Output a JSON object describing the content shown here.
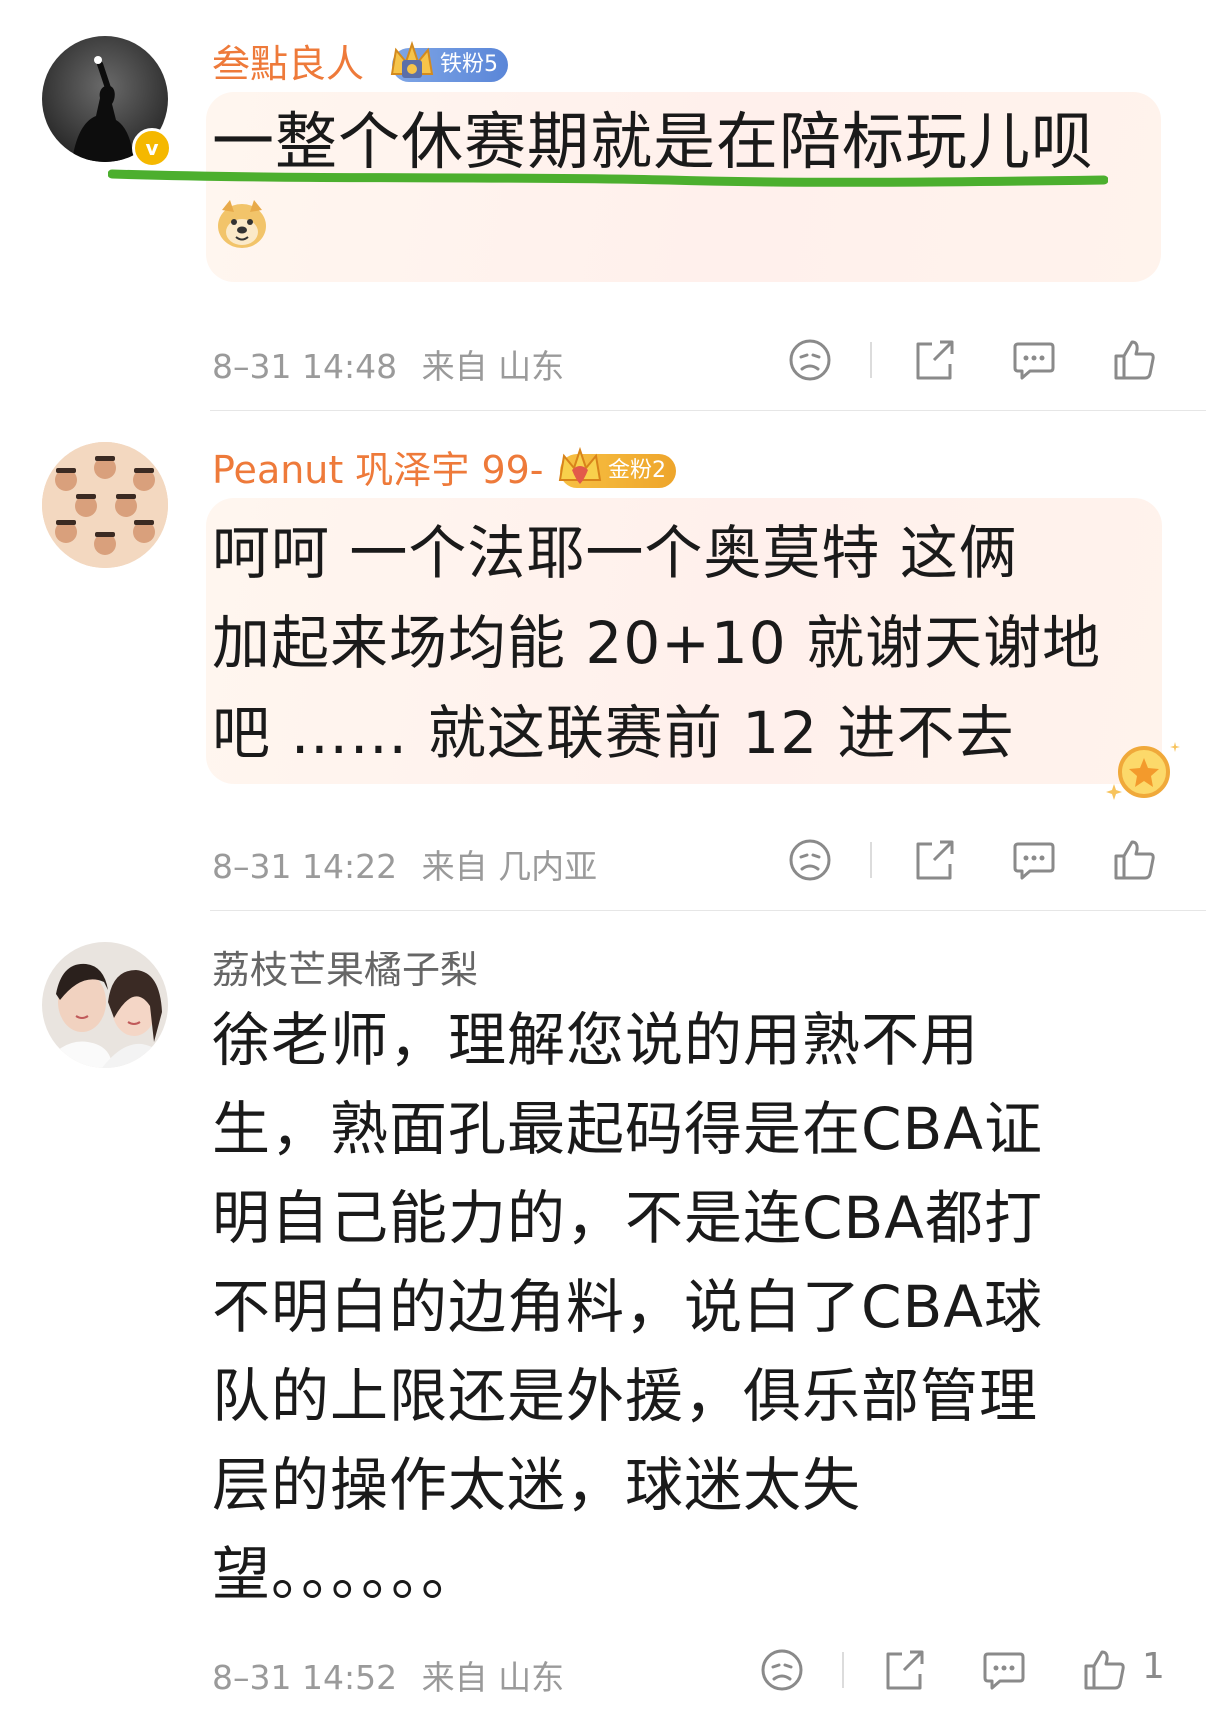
{
  "comments": [
    {
      "username": "叁點良人",
      "badge": "铁粉5",
      "text": "一整个休赛期就是在陪标玩儿呗",
      "emoji": "doge-emoji",
      "time": "8–31 14:48",
      "location": "来自 山东"
    },
    {
      "username": "Peanut 巩泽宇 99-",
      "badge": "金粉2",
      "lines": [
        "呵呵 一个法耶一个奥莫特 这俩",
        "加起来场均能 20+10 就谢天谢地",
        "吧 …… 就这联赛前 12 进不去"
      ],
      "time": "8–31 14:22",
      "location": "来自 几内亚"
    },
    {
      "username": "荔枝芒果橘子梨",
      "lines": [
        "徐老师，理解您说的用熟不用",
        "生，熟面孔最起码得是在CBA证",
        "明自己能力的，不是连CBA都打",
        "不明白的边角料，说白了CBA球",
        "队的上限还是外援，俱乐部管理",
        "层的操作太迷，球迷太失",
        "望。。。。。。"
      ],
      "time": "8–31 14:52",
      "location": "来自 山东",
      "like_count": "1"
    }
  ],
  "colors": {
    "vip_name": "#ee7a3a",
    "meta": "#9a9a9a",
    "underline": "#4caf2e",
    "iron_badge": "#5a86d8",
    "gold_badge": "#f0a92c"
  },
  "icons": [
    "dislike-icon",
    "share-icon",
    "comment-icon",
    "like-icon",
    "verified-icon"
  ]
}
